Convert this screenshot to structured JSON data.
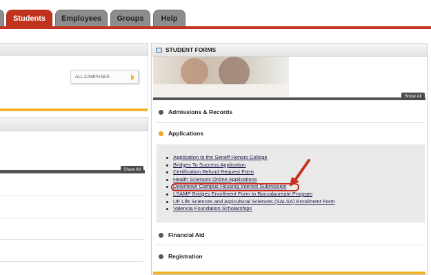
{
  "nav": {
    "tabs": [
      {
        "label": "Students",
        "active": true
      },
      {
        "label": "Employees",
        "active": false
      },
      {
        "label": "Groups",
        "active": false
      },
      {
        "label": "Help",
        "active": false
      }
    ]
  },
  "left": {
    "campus_select": "ALL CAMPUSES",
    "show_all": "Show All"
  },
  "student_forms": {
    "title": "STUDENT FORMS",
    "show_all": "Show All",
    "sections": [
      {
        "label": "Admissions & Records",
        "expanded": false
      },
      {
        "label": "Applications",
        "expanded": true
      },
      {
        "label": "Financial Aid",
        "expanded": false
      },
      {
        "label": "Registration",
        "expanded": false
      }
    ],
    "applications": [
      "Application to the Seneff Honors College",
      "Bridges To Success Application",
      "Certification Refund Request Form",
      "Health Sciences Online Applications",
      "Downtown Campus Housing Interest Submission",
      "LSAMP Bridges Enrollment Form to Baccalaureate Program",
      "UF Life Sciences and Agricultural Sciences (SALSA) Enrollment Form",
      "Valencia Foundation Scholarships"
    ]
  },
  "colors": {
    "accent_red": "#c2331f",
    "gold": "#f0b323",
    "annotation_red": "#c63020"
  }
}
